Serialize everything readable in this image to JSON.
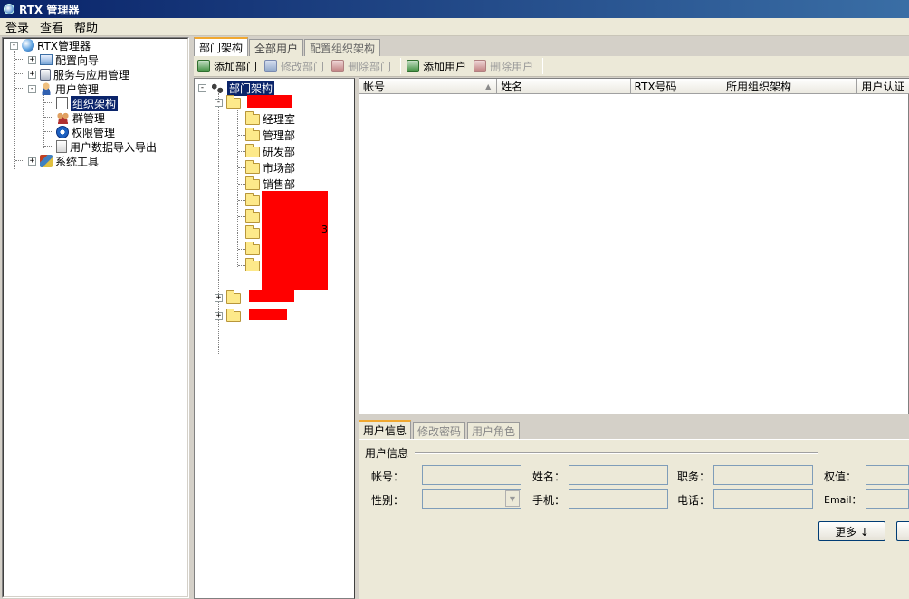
{
  "window": {
    "title": "RTX 管理器"
  },
  "menu": [
    "登录",
    "查看",
    "帮助"
  ],
  "nav_tree": {
    "root": "RTX管理器",
    "items": [
      {
        "label": "配置向导",
        "icon": "wizard-icon",
        "expander": "+"
      },
      {
        "label": "服务与应用管理",
        "icon": "service-icon",
        "expander": "+"
      },
      {
        "label": "用户管理",
        "icon": "users-icon",
        "expander": "-"
      },
      {
        "label": "组织架构",
        "icon": "org-icon",
        "selected": true
      },
      {
        "label": "群管理",
        "icon": "group-icon"
      },
      {
        "label": "权限管理",
        "icon": "permission-icon"
      },
      {
        "label": "用户数据导入导出",
        "icon": "import-export-icon"
      },
      {
        "label": "系统工具",
        "icon": "tools-icon",
        "expander": "+"
      }
    ]
  },
  "tabs": [
    "部门架构",
    "全部用户",
    "配置组织架构"
  ],
  "toolbar": {
    "add_dept": "添加部门",
    "edit_dept": "修改部门",
    "delete_dept": "删除部门",
    "add_user": "添加用户",
    "delete_user": "删除用户"
  },
  "dept_tree": {
    "root": "部门架构",
    "departments": [
      "经理室",
      "管理部",
      "研发部",
      "市场部",
      "销售部"
    ],
    "partial_label_digit": "3"
  },
  "user_table": {
    "columns": [
      "帐号",
      "姓名",
      "RTX号码",
      "所用组织架构",
      "用户认证"
    ]
  },
  "detail": {
    "tabs": [
      "用户信息",
      "修改密码",
      "用户角色"
    ],
    "group_title": "用户信息",
    "labels": {
      "account": "帐号：",
      "name": "姓名：",
      "position": "职务：",
      "weight": "权值：",
      "gender": "性别：",
      "mobile": "手机：",
      "phone": "电话：",
      "email": "Email："
    },
    "more_button": "更多 ↓"
  }
}
